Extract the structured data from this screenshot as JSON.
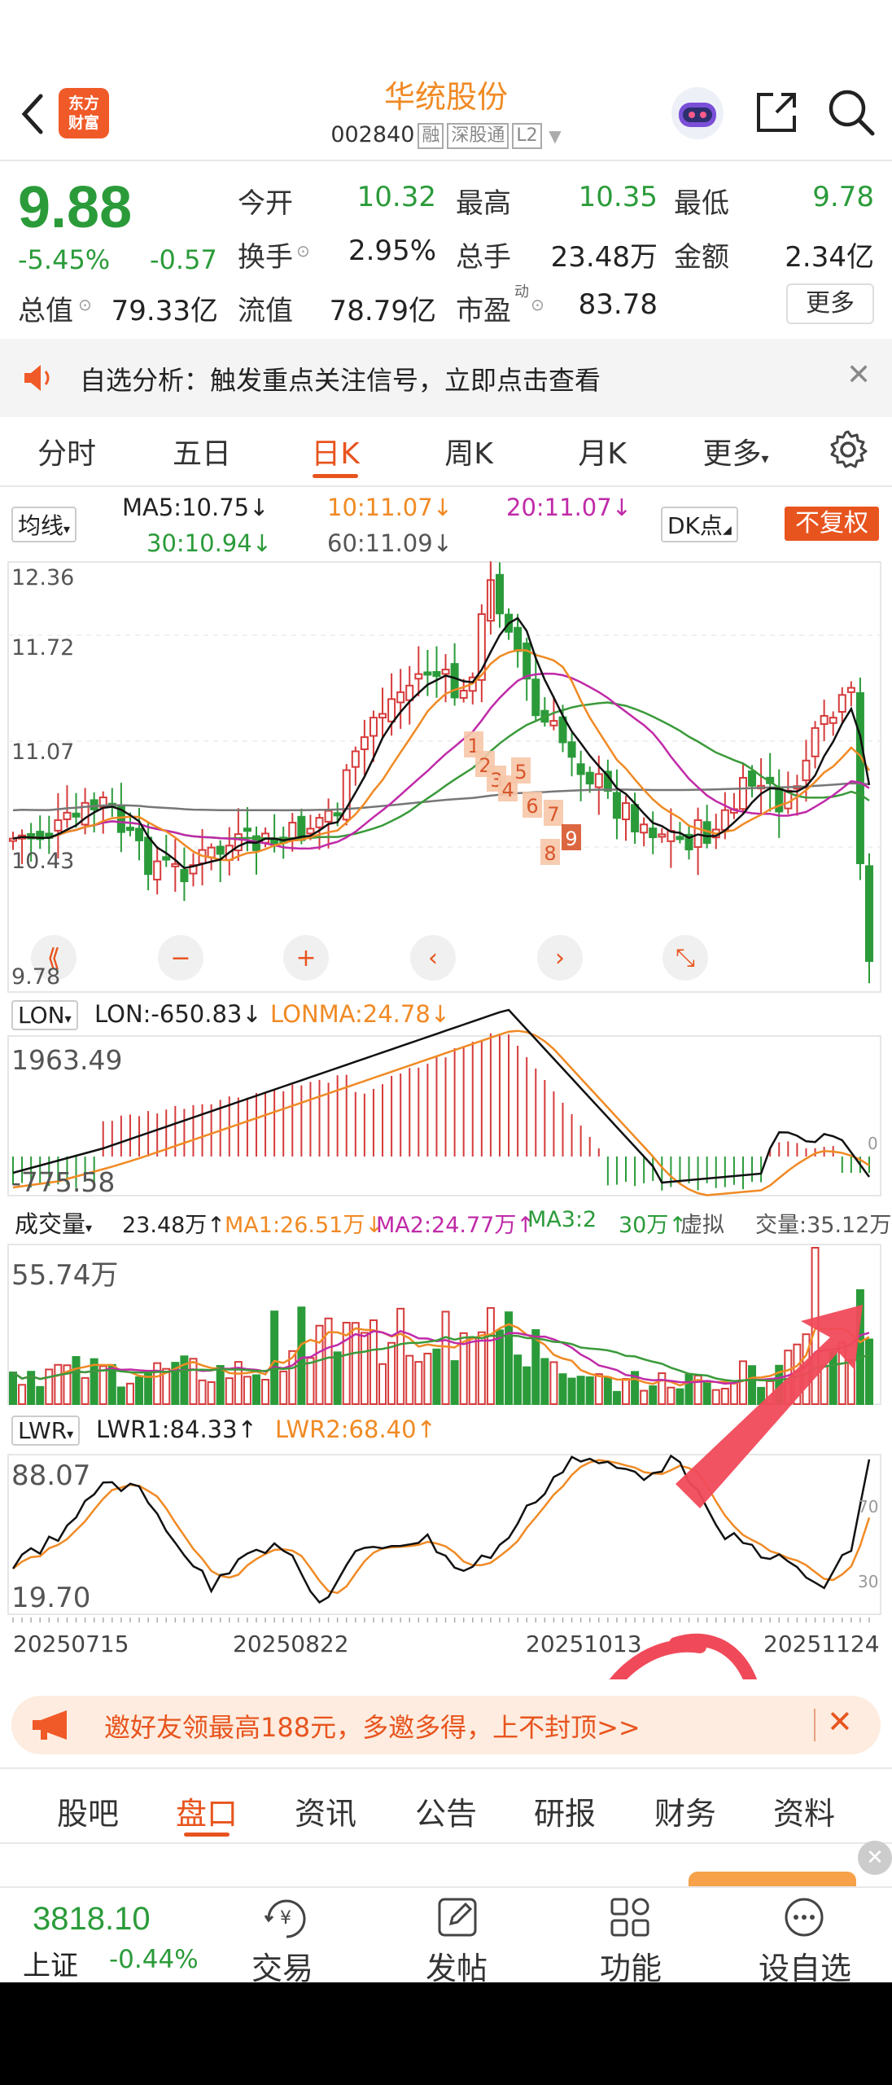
{
  "header": {
    "title": "华统股份",
    "code": "002840",
    "tags": [
      "融",
      "深股通",
      "L2"
    ],
    "logo_text": [
      "东方",
      "财富"
    ]
  },
  "quote": {
    "price": "9.88",
    "change_pct": "-5.45%",
    "change": "-0.57",
    "rows": [
      [
        {
          "label": "今开",
          "value": "10.32",
          "color": "green"
        },
        {
          "label": "最高",
          "value": "10.35",
          "color": "green"
        },
        {
          "label": "最低",
          "value": "9.78",
          "color": "green"
        }
      ],
      [
        {
          "label": "换手",
          "value": "2.95%",
          "color": "black"
        },
        {
          "label": "总手",
          "value": "23.48万",
          "color": "black"
        },
        {
          "label": "金额",
          "value": "2.34亿",
          "color": "black"
        }
      ],
      [
        {
          "label": "总值",
          "value": "79.33亿",
          "color": "black"
        },
        {
          "label": "流值",
          "value": "78.79亿",
          "color": "black"
        },
        {
          "label": "市盈",
          "value": "83.78",
          "color": "black"
        }
      ]
    ],
    "pe_sup": "动",
    "more_label": "更多"
  },
  "banner": {
    "text": "自选分析：触发重点关注信号，立即点击查看"
  },
  "tabs": [
    "分时",
    "五日",
    "日K",
    "周K",
    "月K",
    "更多"
  ],
  "active_tab": "日K",
  "kline": {
    "selector": "均线",
    "ma5": "MA5:10.75",
    "ma10": "10:11.07",
    "ma20": "20:11.07",
    "ma30": "30:10.94",
    "ma60": "60:11.09",
    "dk_label": "DK点",
    "adjust_label": "不复权",
    "y_labels": [
      "12.36",
      "11.72",
      "11.07",
      "10.43",
      "9.78"
    ],
    "seq_labels": [
      "1",
      "2",
      "3",
      "4",
      "5",
      "6",
      "7",
      "8",
      "9"
    ]
  },
  "lon": {
    "selector": "LON",
    "lon": "LON:-650.83",
    "lonma": "LONMA:24.78",
    "y_top": "1963.49",
    "y_bottom": "-775.58",
    "zero": "0"
  },
  "volume": {
    "selector": "成交量",
    "vol": "23.48万",
    "ma1": "MA1:26.51万",
    "ma2": "MA2:24.77万",
    "ma3": "MA3:2",
    "ma3_tail": "30万",
    "virtual": "虚拟",
    "virtual_tail": "交量:35.12万",
    "y_top": "55.74万"
  },
  "lwr": {
    "selector": "LWR",
    "lwr1": "LWR1:84.33",
    "lwr2": "LWR2:68.40",
    "y_top": "88.07",
    "y_bottom": "19.70",
    "right_top": "70",
    "right_bottom": "30"
  },
  "dates": [
    "20250715",
    "20250822",
    "20251013",
    "20251124"
  ],
  "promo": {
    "text": "邀好友领最高188元，多邀多得，上不封顶>>"
  },
  "bottom_tabs": [
    "股吧",
    "盘口",
    "资讯",
    "公告",
    "研报",
    "财务",
    "资料"
  ],
  "bottom_active": "盘口",
  "footer": {
    "index_value": "3818.10",
    "index_name": "上证",
    "index_change": "-0.44%",
    "items": [
      "交易",
      "发帖",
      "功能",
      "设自选"
    ]
  },
  "colors": {
    "accent": "#f08a24",
    "up": "#e03d3d",
    "down": "#2b9b3a",
    "brand": "#e8541e"
  }
}
